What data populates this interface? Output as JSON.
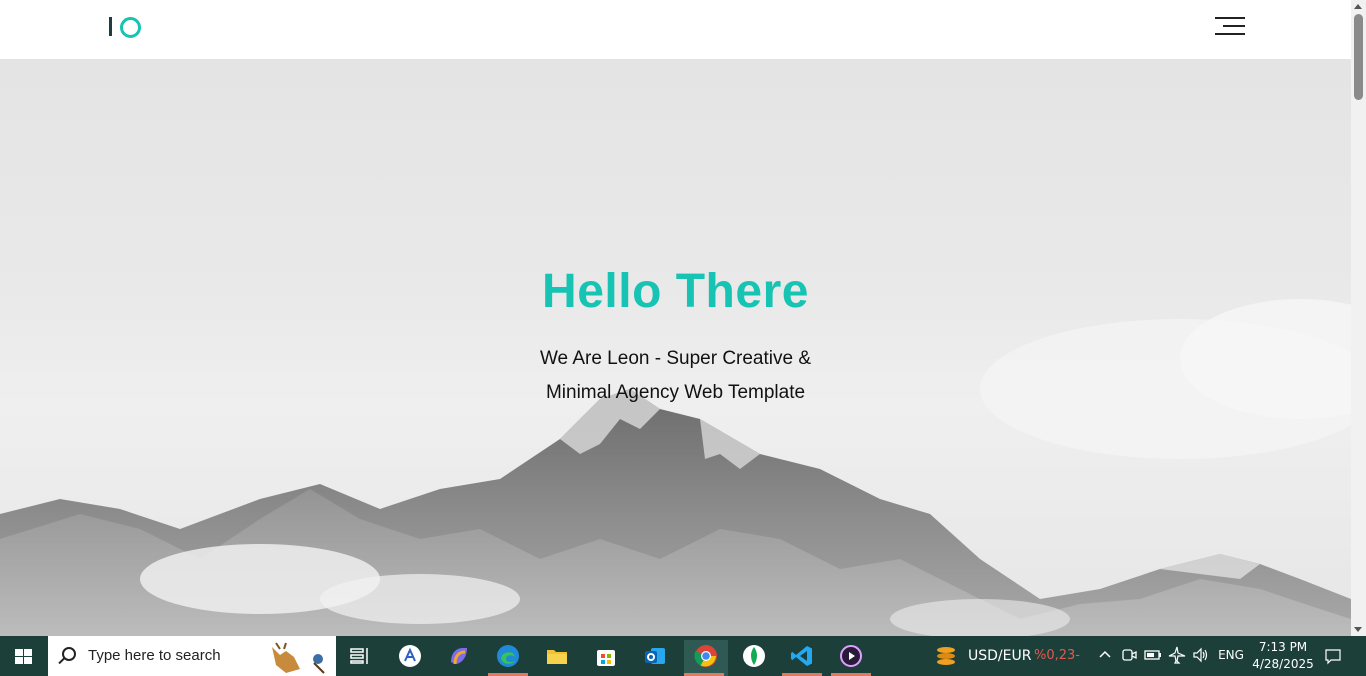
{
  "header": {
    "logo_icon": "io-logo",
    "menu_icon": "hamburger-menu-icon"
  },
  "hero": {
    "title": "Hello There",
    "subtitle_line1": "We Are Leon - Super Creative &",
    "subtitle_line2": "Minimal Agency Web Template",
    "accent_color": "#17c3b2"
  },
  "taskbar": {
    "search_placeholder": "Type here to search",
    "apps": [
      {
        "name": "task-view"
      },
      {
        "name": "app-a"
      },
      {
        "name": "copilot"
      },
      {
        "name": "edge"
      },
      {
        "name": "file-explorer"
      },
      {
        "name": "microsoft-store"
      },
      {
        "name": "outlook"
      },
      {
        "name": "chrome"
      },
      {
        "name": "mongodb-compass"
      },
      {
        "name": "vscode"
      },
      {
        "name": "media-player"
      }
    ],
    "widget_label": "USD/EUR",
    "widget_value": "%0,23-",
    "widget_value_color": "#e05a4f",
    "language": "ENG",
    "time": "7:13 PM",
    "date": "4/28/2025"
  }
}
